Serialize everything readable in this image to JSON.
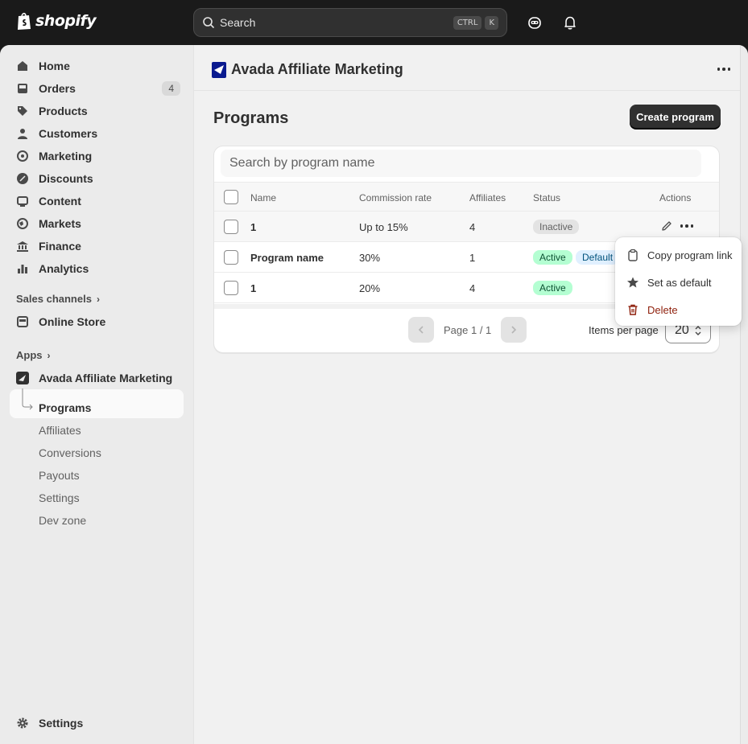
{
  "topbar": {
    "brand": "shopify",
    "search_label": "Search",
    "shortcut_keys": [
      "CTRL",
      "K"
    ]
  },
  "sidebar": {
    "items": [
      {
        "label": "Home",
        "icon": "home-icon"
      },
      {
        "label": "Orders",
        "icon": "orders-icon",
        "badge": "4"
      },
      {
        "label": "Products",
        "icon": "tag-icon"
      },
      {
        "label": "Customers",
        "icon": "person-icon"
      },
      {
        "label": "Marketing",
        "icon": "target-icon"
      },
      {
        "label": "Discounts",
        "icon": "discount-icon"
      },
      {
        "label": "Content",
        "icon": "content-icon"
      },
      {
        "label": "Markets",
        "icon": "globe-icon"
      },
      {
        "label": "Finance",
        "icon": "bank-icon"
      },
      {
        "label": "Analytics",
        "icon": "chart-icon"
      }
    ],
    "sales_channels_label": "Sales channels",
    "online_store_label": "Online Store",
    "apps_label": "Apps",
    "app_name": "Avada Affiliate Marketing",
    "app_subitems": [
      "Programs",
      "Affiliates",
      "Conversions",
      "Payouts",
      "Settings",
      "Dev zone"
    ],
    "settings_label": "Settings"
  },
  "app": {
    "title": "Avada Affiliate Marketing"
  },
  "page": {
    "title": "Programs",
    "create_button": "Create program",
    "search_placeholder": "Search by program name"
  },
  "table": {
    "columns": [
      "Name",
      "Commission rate",
      "Affiliates",
      "Status",
      "Actions"
    ],
    "rows": [
      {
        "name": "1",
        "commission": "Up to 15%",
        "affiliates": "4",
        "status": "Inactive"
      },
      {
        "name": "Program name",
        "commission": "30%",
        "affiliates": "1",
        "status": "Active",
        "extra_badge": "Default"
      },
      {
        "name": "1",
        "commission": "20%",
        "affiliates": "4",
        "status": "Active"
      }
    ]
  },
  "pagination": {
    "page_text": "Page 1 / 1",
    "items_per_page_label": "Items per page",
    "items_per_page_value": "20"
  },
  "popover": {
    "items": [
      {
        "label": "Copy program link",
        "icon": "clipboard-icon"
      },
      {
        "label": "Set as default",
        "icon": "star-icon"
      },
      {
        "label": "Delete",
        "icon": "trash-icon"
      }
    ]
  },
  "colors": {
    "topbar_bg": "#1a1a1a",
    "primary_button": "#303030",
    "active_badge": "#b4fed2",
    "inactive_badge": "#e3e3e3",
    "default_badge": "#e0f0ff",
    "danger": "#8e1f0b"
  }
}
